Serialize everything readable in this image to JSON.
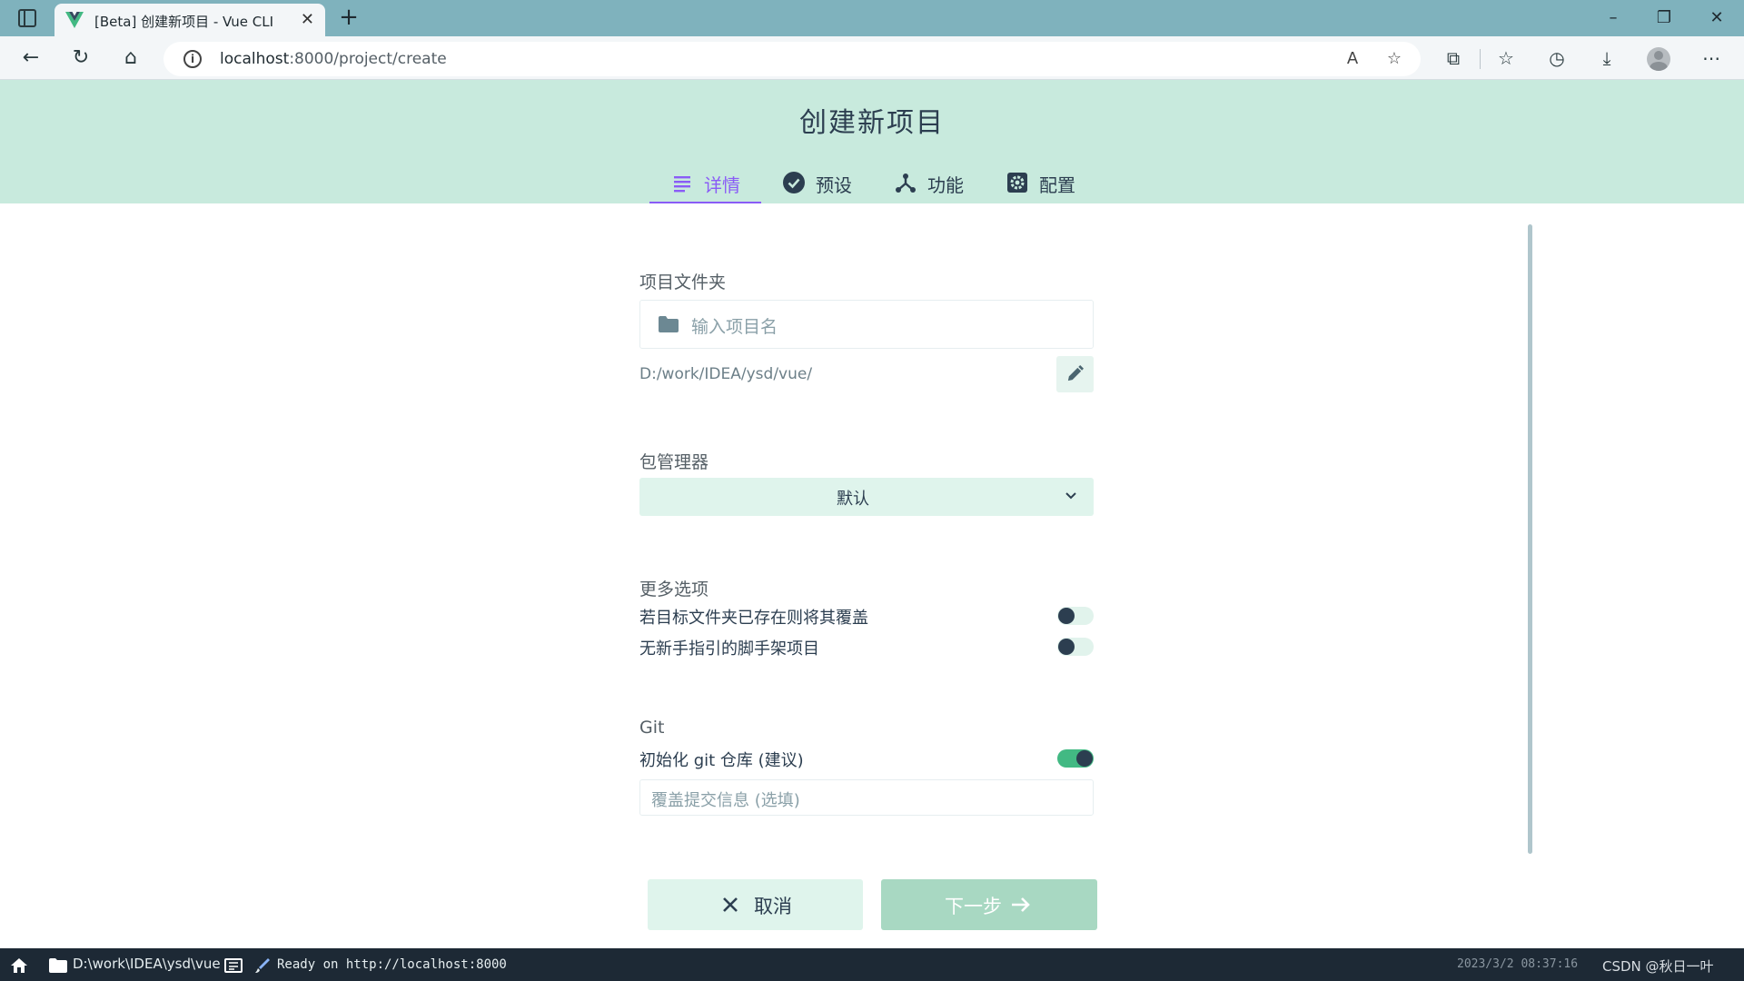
{
  "browser": {
    "tab_title": "[Beta] 创建新项目 - Vue CLI",
    "url_host": "localhost",
    "url_rest": ":8000/project/create"
  },
  "page": {
    "title": "创建新项目",
    "tabs": [
      {
        "label": "详情",
        "icon": "list-icon",
        "active": true
      },
      {
        "label": "预设",
        "icon": "check-circle-icon",
        "active": false
      },
      {
        "label": "功能",
        "icon": "fork-icon",
        "active": false
      },
      {
        "label": "配置",
        "icon": "gear-icon",
        "active": false
      }
    ]
  },
  "form": {
    "folder": {
      "label": "项目文件夹",
      "placeholder": "输入项目名",
      "path": "D:/work/IDEA/ysd/vue/"
    },
    "package_manager": {
      "label": "包管理器",
      "selected": "默认"
    },
    "more_options": {
      "label": "更多选项",
      "options": [
        {
          "label": "若目标文件夹已存在则将其覆盖",
          "on": false
        },
        {
          "label": "无新手指引的脚手架项目",
          "on": false
        }
      ]
    },
    "git": {
      "label": "Git",
      "init_label": "初始化 git 仓库 (建议)",
      "init_on": true,
      "commit_placeholder": "覆盖提交信息 (选填)"
    }
  },
  "buttons": {
    "cancel": "取消",
    "next": "下一步"
  },
  "status_bar": {
    "folder": "D:\\work\\IDEA\\ysd\\vue",
    "ready": "Ready on http://localhost:8000",
    "datetime": "2023/3/2 08:37:16",
    "watermark": "CSDN @秋日一叶"
  },
  "colors": {
    "header_bg": "#c8eadd",
    "accent_purple": "#8a5cf6",
    "vue_green": "#42b983"
  }
}
